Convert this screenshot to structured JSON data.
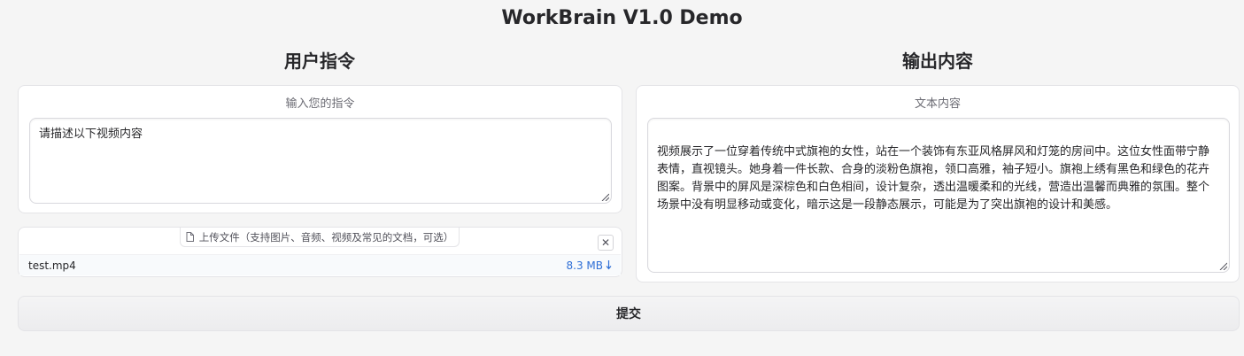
{
  "app": {
    "title": "WorkBrain V1.0 Demo"
  },
  "left": {
    "heading": "用户指令",
    "instruction_label": "输入您的指令",
    "instruction_value": "请描述以下视频内容",
    "upload_label": "上传文件（支持图片、音频、视频及常见的文档，可选）",
    "file_name": "test.mp4",
    "file_size": "8.3 MB",
    "file_size_icon": "download-arrow-icon",
    "close_glyph": "✕"
  },
  "right": {
    "heading": "输出内容",
    "output_label": "文本内容",
    "output_value": "视频展示了一位穿着传统中式旗袍的女性，站在一个装饰有东亚风格屏风和灯笼的房间中。这位女性面带宁静表情，直视镜头。她身着一件长款、合身的淡粉色旗袍，领口高雅，袖子短小。旗袍上绣有黑色和绿色的花卉图案。背景中的屏风是深棕色和白色相间，设计复杂，透出温暖柔和的光线，营造出温馨而典雅的氛围。整个场景中没有明显移动或变化，暗示这是一段静态展示，可能是为了突出旗袍的设计和美感。"
  },
  "actions": {
    "submit_label": "提交"
  },
  "colors": {
    "accent_link": "#2f6fd6",
    "background": "#f5f5f5",
    "panel": "#ffffff"
  }
}
